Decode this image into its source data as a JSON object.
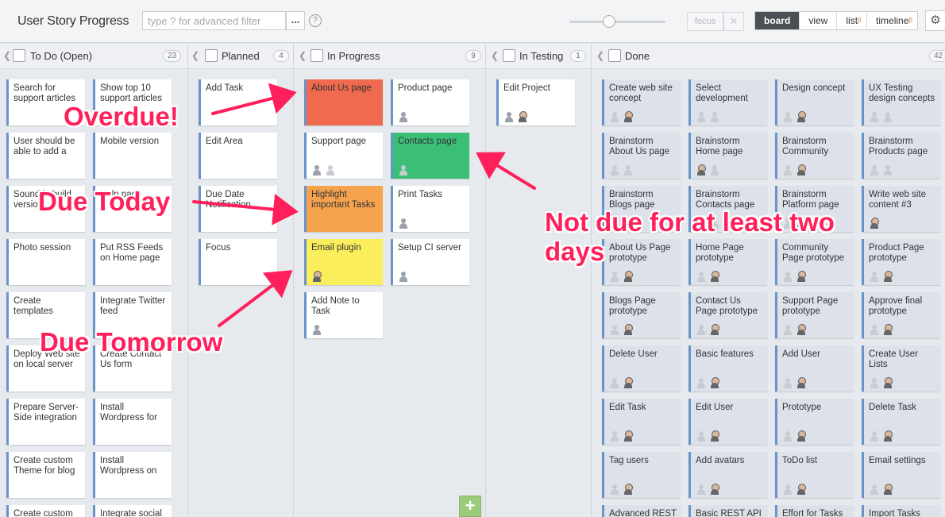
{
  "header": {
    "title": "User Story Progress",
    "search_placeholder": "type ? for advanced filter",
    "more_label": "...",
    "help_label": "?",
    "focus_label": "focus",
    "close_label": "✕",
    "tabs": [
      {
        "label": "board",
        "active": true,
        "beta": ""
      },
      {
        "label": "view",
        "active": false,
        "beta": ""
      },
      {
        "label": "list",
        "active": false,
        "beta": "β"
      },
      {
        "label": "timeline",
        "active": false,
        "beta": "β"
      }
    ],
    "settings_icon": "gear-icon"
  },
  "columns": [
    {
      "title": "To Do (Open)",
      "count": "23"
    },
    {
      "title": "Planned",
      "count": "4"
    },
    {
      "title": "In Progress",
      "count": "9"
    },
    {
      "title": "In Testing",
      "count": "1"
    },
    {
      "title": "Done",
      "count": "42"
    }
  ],
  "cards": {
    "todo": [
      "Search for support articles",
      "Show top 10 support articles",
      "User should be able to add a",
      "Mobile version",
      "Sound in build version",
      "Help page",
      "Photo session",
      "Put RSS Feeds on Home page",
      "Create templates",
      "Integrate Twitter feed",
      "Deploy Web site on local server",
      "Create Contact Us form",
      "Prepare Server-Side integration",
      "Install Wordpress for",
      "Create custom Theme for blog",
      "Install Wordpress on",
      "Create custom",
      "Integrate social"
    ],
    "planned": [
      "Add Task",
      "Edit Area",
      "Due Date Notification",
      "Focus"
    ],
    "in_progress": [
      {
        "text": "About Us page",
        "status": "overdue"
      },
      {
        "text": "Product page",
        "status": "normal"
      },
      {
        "text": "Support page",
        "status": "normal"
      },
      {
        "text": "Contacts page",
        "status": "later"
      },
      {
        "text": "Highlight important Tasks",
        "status": "today"
      },
      {
        "text": "Print Tasks",
        "status": "normal"
      },
      {
        "text": "Email plugin",
        "status": "tomorrow"
      },
      {
        "text": "Setup CI server",
        "status": "normal"
      },
      {
        "text": "Add Note to Task",
        "status": "normal"
      }
    ],
    "in_testing": [
      "Edit Project"
    ],
    "done": [
      "Create web site concept",
      "Select development",
      "Design concept",
      "UX Testing design concepts",
      "Brainstorm About Us page",
      "Brainstorm Home page",
      "Brainstorm Community",
      "Brainstorm Products page",
      "Brainstorm Blogs page",
      "Brainstorm Contacts page",
      "Brainstorm Platform page",
      "Write web site content #3",
      "About Us Page prototype",
      "Home Page prototype",
      "Community Page prototype",
      "Product Page prototype",
      "Blogs Page prototype",
      "Contact Us Page prototype",
      "Support Page prototype",
      "Approve final prototype",
      "Delete User",
      "Basic features",
      "Add User",
      "Create User Lists",
      "Edit Task",
      "Edit User",
      "Prototype",
      "Delete Task",
      "Tag users",
      "Add avatars",
      "ToDo list",
      "Email settings",
      "Advanced REST",
      "Basic REST API",
      "Effort for Tasks",
      "Import Tasks"
    ]
  },
  "annotations": {
    "overdue": "Overdue!",
    "today": "Due Today",
    "later": "Not due for at least two days",
    "tomorrow": "Due Tomorrow"
  },
  "colors": {
    "overdue": "#ef6a4f",
    "today": "#f6a34e",
    "tomorrow": "#fbee5d",
    "later": "#3bbf77",
    "annotation": "#ff1f5a"
  },
  "add_button_label": "+"
}
